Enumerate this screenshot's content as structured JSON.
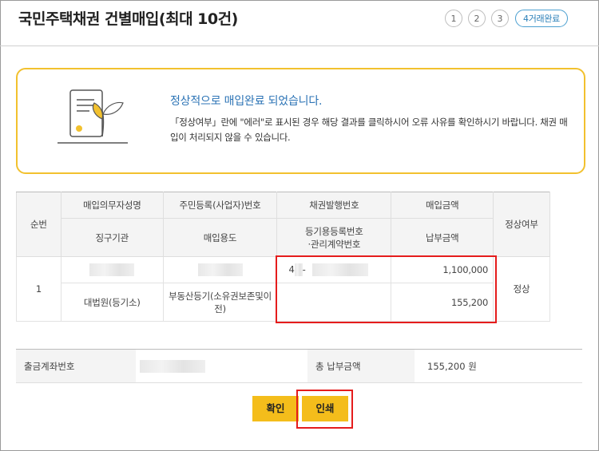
{
  "page": {
    "title": "국민주택채권 건별매입(최대 10건)"
  },
  "steps": [
    "1",
    "2",
    "3"
  ],
  "step_done": "4거래완료",
  "notice": {
    "heading": "정상적으로 매입완료 되었습니다.",
    "body": "「정상여부」란에 \"에러\"로 표시된 경우 해당 결과를 클릭하시어 오류 사유를 확인하시기 바랍니다. 채권 매입이 처리되지 않을 수 있습니다."
  },
  "table": {
    "headers": {
      "seq": "순번",
      "obligor": "매입의무자성명",
      "reg_no": "주민등록(사업자)번호",
      "bond_no": "채권발행번호",
      "amount": "매입금액",
      "status": "정상여부",
      "agency": "징구기관",
      "purpose": "매입용도",
      "reg_mgmt_no_1": "등기용등록번호",
      "reg_mgmt_no_2": "·관리계약번호",
      "payment": "납부금액"
    },
    "rows": [
      {
        "seq": "1",
        "bond_prefix": "4",
        "bond_dash": "-",
        "amount": "1,100,000",
        "status": "정상",
        "agency": "대법원(등기소)",
        "purpose": "부동산등기(소유권보존및이전)",
        "payment": "155,200"
      }
    ]
  },
  "account": {
    "label": "출금계좌번호",
    "total_label": "총 납부금액",
    "total_value": "155,200 원"
  },
  "buttons": {
    "confirm": "확인",
    "print": "인쇄"
  },
  "colors": {
    "accent_yellow": "#f4bd1b",
    "notice_border": "#f2c12e",
    "notice_heading": "#2b73b5",
    "highlight_red": "#e51c1c",
    "step_done_blue": "#4a9fd0"
  }
}
